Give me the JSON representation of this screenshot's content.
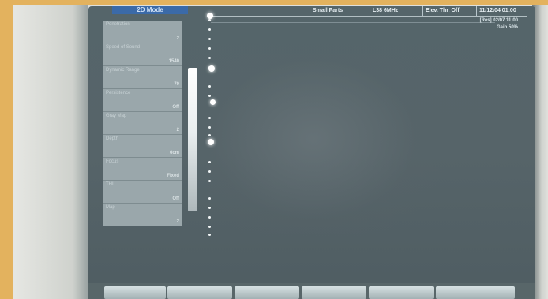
{
  "device": {
    "mode_tab": "2D Mode",
    "top_bar": {
      "segments": [
        "Small Parts",
        "L38 6MHz",
        "Elev. Thr. Off",
        "11/12/04 01:00"
      ]
    },
    "info_right": [
      "[Res] 02/07 11:00",
      "Gain 50%"
    ],
    "parameters": [
      {
        "label": "Penetration",
        "value": "2"
      },
      {
        "label": "Speed of Sound",
        "value": "1540"
      },
      {
        "label": "Dynamic Range",
        "value": "70"
      },
      {
        "label": "Persistence",
        "value": "Off"
      },
      {
        "label": "Gray Map",
        "value": "2"
      },
      {
        "label": "Depth",
        "value": "6cm"
      },
      {
        "label": "Focus",
        "value": "Fixed"
      },
      {
        "label": "THI",
        "value": "Off"
      },
      {
        "label": "Map",
        "value": "2"
      }
    ],
    "bottom_buttons": [
      "",
      "",
      "",
      "",
      "",
      ""
    ]
  }
}
